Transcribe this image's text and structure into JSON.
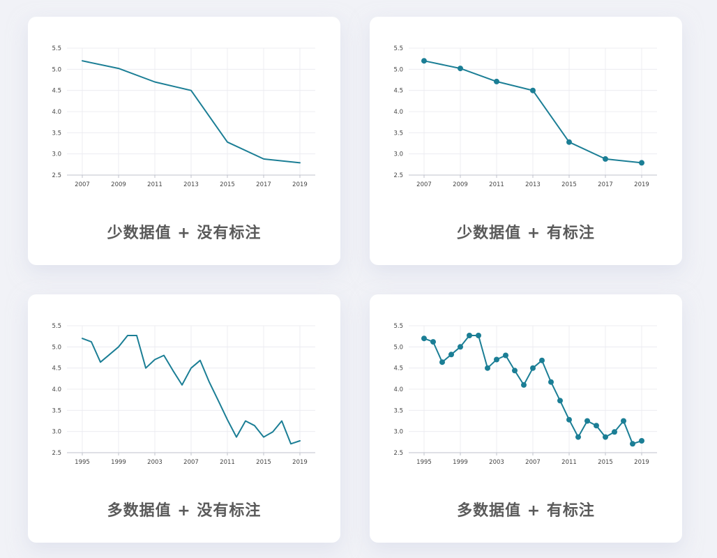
{
  "colors": {
    "line": "#1b7e95",
    "grid": "#ececf1",
    "axis": "#bfc2cb",
    "caption": "#5a5a5a"
  },
  "cards": [
    {
      "caption": "少数据值 + 没有标注"
    },
    {
      "caption": "少数据值 + 有标注"
    },
    {
      "caption": "多数据值 + 没有标注"
    },
    {
      "caption": "多数据值 + 有标注"
    }
  ],
  "chart_data": [
    {
      "type": "line",
      "markers": false,
      "x": [
        2007,
        2009,
        2011,
        2013,
        2015,
        2017,
        2019
      ],
      "y": [
        5.2,
        5.02,
        4.7,
        4.5,
        3.28,
        2.88,
        2.79
      ],
      "xlim": [
        2007,
        2019
      ],
      "ylim": [
        2.5,
        5.5
      ],
      "xticks": [
        "2007",
        "2009",
        "2011",
        "2013",
        "2015",
        "2017",
        "2019"
      ],
      "yticks": [
        "2.5",
        "3.0",
        "3.5",
        "4.0",
        "4.5",
        "5.0",
        "5.5"
      ],
      "grid": true,
      "title": "少数据值 + 没有标注"
    },
    {
      "type": "line",
      "markers": true,
      "x": [
        2007,
        2009,
        2011,
        2013,
        2015,
        2017,
        2019
      ],
      "y": [
        5.2,
        5.02,
        4.71,
        4.5,
        3.28,
        2.88,
        2.79
      ],
      "xlim": [
        2007,
        2019
      ],
      "ylim": [
        2.5,
        5.5
      ],
      "xticks": [
        "2007",
        "2009",
        "2011",
        "2013",
        "2015",
        "2017",
        "2019"
      ],
      "yticks": [
        "2.5",
        "3.0",
        "3.5",
        "4.0",
        "4.5",
        "5.0",
        "5.5"
      ],
      "grid": true,
      "title": "少数据值 + 有标注"
    },
    {
      "type": "line",
      "markers": false,
      "x": [
        1995,
        1996,
        1997,
        1998,
        1999,
        2000,
        2001,
        2002,
        2003,
        2004,
        2005,
        2006,
        2007,
        2008,
        2009,
        2010,
        2011,
        2012,
        2013,
        2014,
        2015,
        2016,
        2017,
        2018,
        2019
      ],
      "y": [
        5.2,
        5.12,
        4.64,
        4.82,
        5.0,
        5.27,
        5.27,
        4.5,
        4.7,
        4.8,
        4.44,
        4.1,
        4.5,
        4.68,
        4.17,
        3.73,
        3.28,
        2.87,
        3.25,
        3.14,
        2.87,
        2.99,
        3.25,
        2.71,
        2.78
      ],
      "xlim": [
        1995,
        2019
      ],
      "ylim": [
        2.5,
        5.5
      ],
      "xticks": [
        "1995",
        "1999",
        "2003",
        "2007",
        "2011",
        "2015",
        "2019"
      ],
      "yticks": [
        "2.5",
        "3.0",
        "3.5",
        "4.0",
        "4.5",
        "5.0",
        "5.5"
      ],
      "grid": true,
      "title": "多数据值 + 没有标注"
    },
    {
      "type": "line",
      "markers": true,
      "x": [
        1995,
        1996,
        1997,
        1998,
        1999,
        2000,
        2001,
        2002,
        2003,
        2004,
        2005,
        2006,
        2007,
        2008,
        2009,
        2010,
        2011,
        2012,
        2013,
        2014,
        2015,
        2016,
        2017,
        2018,
        2019
      ],
      "y": [
        5.2,
        5.12,
        4.64,
        4.82,
        5.0,
        5.27,
        5.27,
        4.5,
        4.7,
        4.8,
        4.44,
        4.1,
        4.5,
        4.68,
        4.17,
        3.73,
        3.28,
        2.87,
        3.25,
        3.14,
        2.87,
        2.99,
        3.25,
        2.71,
        2.78
      ],
      "xlim": [
        1995,
        2019
      ],
      "ylim": [
        2.5,
        5.5
      ],
      "xticks": [
        "1995",
        "1999",
        "2003",
        "2007",
        "2011",
        "2015",
        "2019"
      ],
      "yticks": [
        "2.5",
        "3.0",
        "3.5",
        "4.0",
        "4.5",
        "5.0",
        "5.5"
      ],
      "grid": true,
      "title": "多数据值 + 有标注"
    }
  ]
}
